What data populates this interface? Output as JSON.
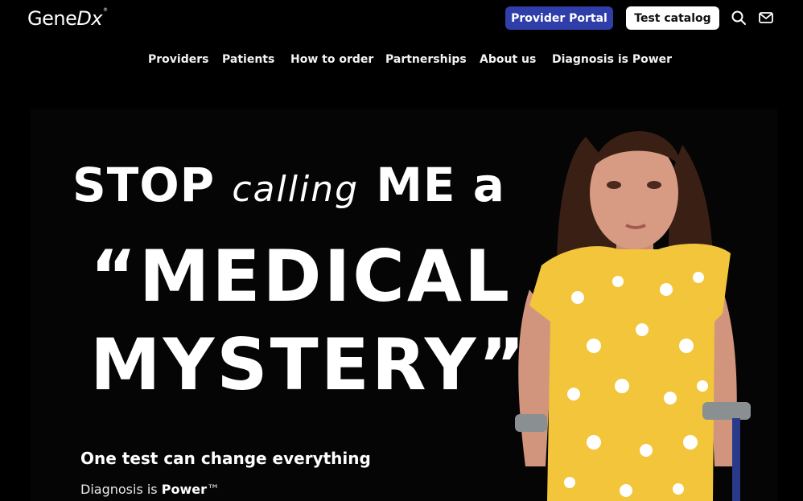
{
  "header": {
    "logo_text": "GeneDx",
    "logo_main": "Gene",
    "logo_dx": "Dx",
    "provider_portal_label": "Provider Portal",
    "test_catalog_label": "Test catalog",
    "icons": [
      "search-icon",
      "mail-icon"
    ]
  },
  "nav": {
    "items": [
      {
        "label": "Providers"
      },
      {
        "label": "Patients"
      },
      {
        "label": "How to order"
      },
      {
        "label": "Partnerships"
      },
      {
        "label": "About us"
      },
      {
        "label": "Diagnosis is Power"
      }
    ]
  },
  "hero": {
    "line1_a": "STOP",
    "line1_b": "calling",
    "line1_c": "ME a",
    "line2": "“MEDICAL",
    "line3": "MYSTERY”",
    "tagline": "One test can change everything",
    "sub_prefix": "Diagnosis is ",
    "sub_bold": "Power",
    "sub_tm": "™"
  },
  "colors": {
    "background": "#000000",
    "portal_button": "#2f3ea8",
    "catalog_button": "#ffffff",
    "shirt_yellow": "#f2c53a"
  }
}
